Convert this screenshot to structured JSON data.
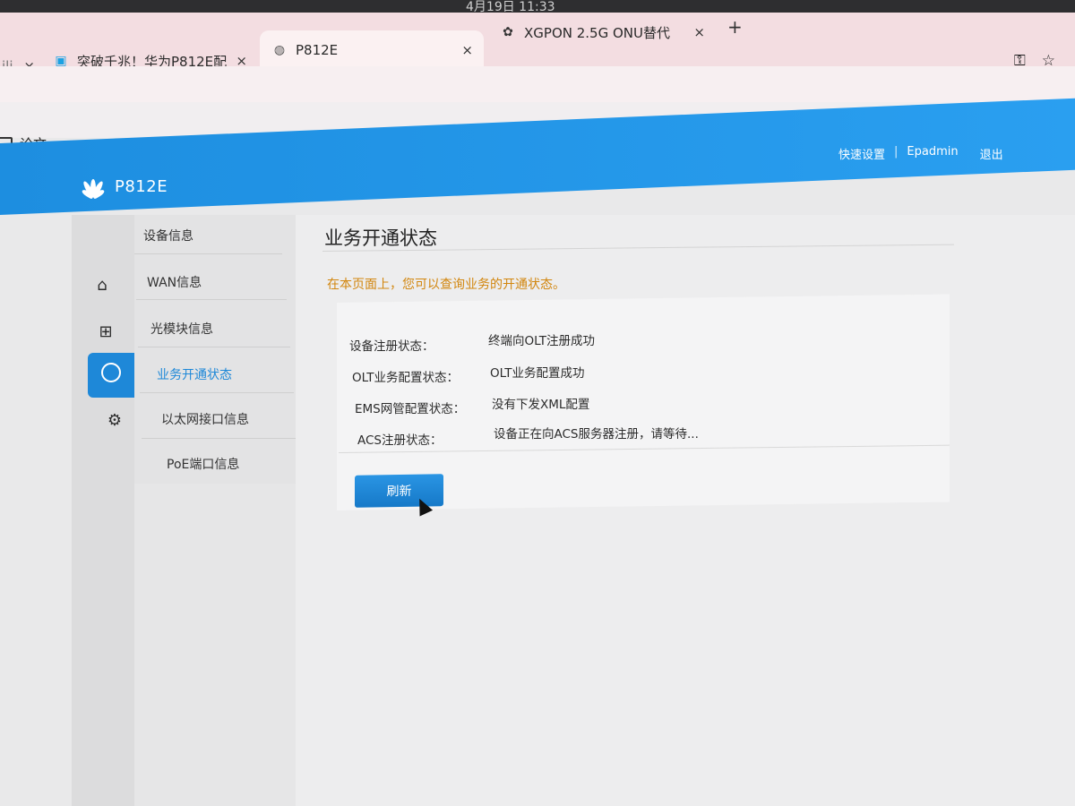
{
  "os": {
    "clock": "4月19日 11:33"
  },
  "browser": {
    "tabs": [
      {
        "title": "ili",
        "favicon": "",
        "close": "×"
      },
      {
        "title": "突破千兆！华为P812E配",
        "favicon": "tv-icon",
        "close": "×"
      },
      {
        "title": "P812E",
        "favicon": "globe-icon",
        "close": "×"
      },
      {
        "title": "XGPON 2.5G ONU替代",
        "favicon": "openai-icon",
        "close": "×"
      }
    ],
    "new_tab": "+",
    "bookmark": "论文",
    "toolbar_icons": [
      "key-icon",
      "star-icon"
    ]
  },
  "router": {
    "brand": "P812E",
    "header_links": {
      "quick_setup": "快速设置",
      "separator": "|",
      "user": "Epadmin",
      "logout": "退出"
    },
    "menu": [
      {
        "label": "设备信息"
      },
      {
        "label": "WAN信息"
      },
      {
        "label": "光模块信息"
      },
      {
        "label": "业务开通状态",
        "active": true
      },
      {
        "label": "以太网接口信息"
      },
      {
        "label": "PoE端口信息"
      }
    ],
    "rail_icons": [
      "home-icon",
      "medical-box-icon",
      "status-gauge-icon",
      "gear-icon"
    ],
    "page": {
      "title": "业务开通状态",
      "description": "在本页面上，您可以查询业务的开通状态。",
      "rows": [
        {
          "label": "设备注册状态：",
          "value": "终端向OLT注册成功"
        },
        {
          "label": "OLT业务配置状态：",
          "value": "OLT业务配置成功"
        },
        {
          "label": "EMS网管配置状态：",
          "value": "没有下发XML配置"
        },
        {
          "label": "ACS注册状态：",
          "value": "设备正在向ACS服务器注册，请等待..."
        }
      ],
      "refresh_label": "刷新"
    }
  }
}
